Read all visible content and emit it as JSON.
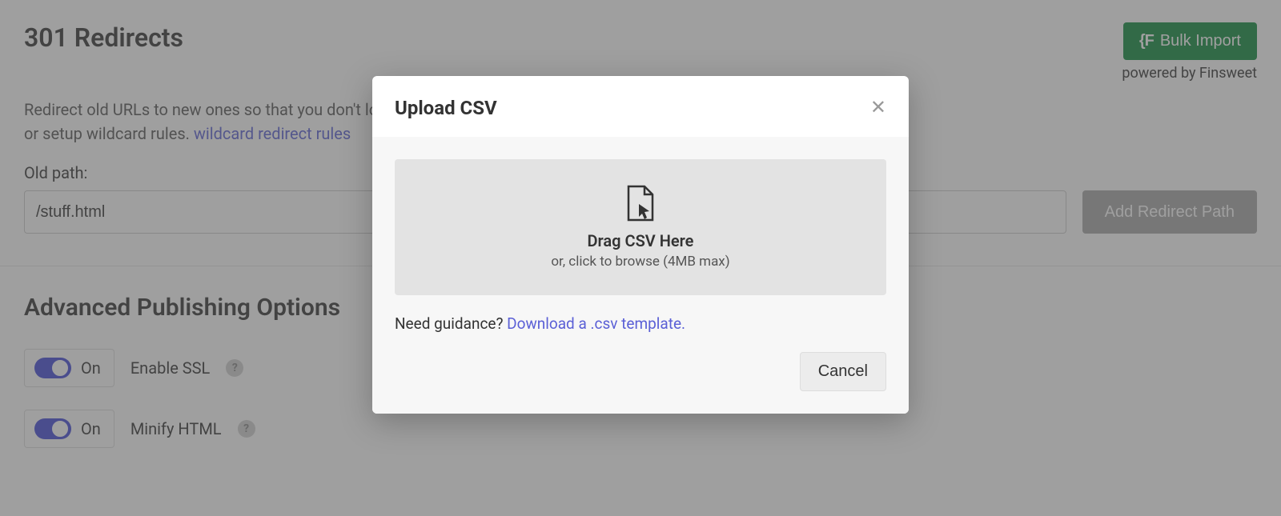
{
  "header": {
    "title": "301 Redirects",
    "bulk_import_label": "Bulk Import",
    "powered_by": "powered by Finsweet"
  },
  "description": {
    "text": "Redirect old URLs to new ones so that you don't lose any traffic or search engine positioning. Redirect to a page, full domain, or setup wildcard rules. ",
    "link": "wildcard redirect rules"
  },
  "form": {
    "old_label": "Old path:",
    "old_value": "/stuff.html",
    "add_label": "Add Redirect Path"
  },
  "advanced": {
    "title": "Advanced Publishing Options",
    "toggle_state": "On",
    "ssl_label": "Enable SSL",
    "minify_label": "Minify HTML"
  },
  "modal": {
    "title": "Upload CSV",
    "drag_title": "Drag CSV Here",
    "drag_sub": "or, click to browse (4MB max)",
    "guidance_text": "Need guidance? ",
    "guidance_link": "Download a .csv template.",
    "cancel_label": "Cancel"
  }
}
